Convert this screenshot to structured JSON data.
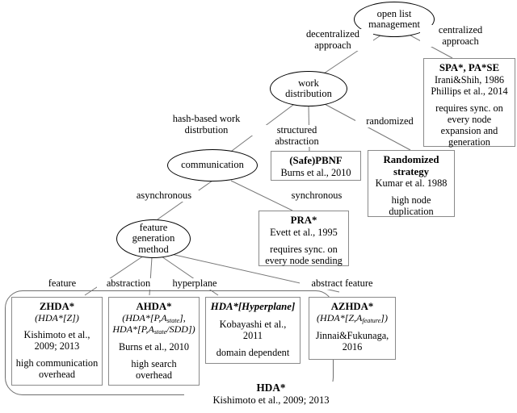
{
  "diagram": {
    "title": "open list management taxonomy",
    "root": {
      "label_line1": "open list",
      "label_line2": "management"
    },
    "nodes": {
      "work_distribution": {
        "line1": "work",
        "line2": "distribution"
      },
      "communication": {
        "line1": "communication"
      },
      "feature_generation": {
        "line1": "feature",
        "line2": "generation",
        "line3": "method"
      }
    },
    "edge_labels": {
      "decentralized": {
        "line1": "decentralized",
        "line2": "approach"
      },
      "centralized": {
        "line1": "centralized",
        "line2": "approach"
      },
      "hash_based": {
        "line1": "hash-based work",
        "line2": "distrbution"
      },
      "structured": {
        "line1": "structured",
        "line2": "abstraction"
      },
      "randomized": {
        "line1": "randomized"
      },
      "asynchronous": {
        "line1": "asynchronous"
      },
      "synchronous": {
        "line1": "synchronous"
      },
      "feature": {
        "line1": "feature"
      },
      "abstraction": {
        "line1": "abstraction"
      },
      "hyperplane": {
        "line1": "hyperplane"
      },
      "abstract_feature": {
        "line1": "abstract feature"
      }
    },
    "boxes": {
      "spa": {
        "title": "SPA*, PA*SE",
        "ref1": "Irani&Shih, 1986",
        "ref2": "Phillips et al., 2014",
        "note1": "requires sync. on",
        "note2": "every node",
        "note3": "expansion and",
        "note4": "generation"
      },
      "safepbnf": {
        "title": "(Safe)PBNF",
        "ref1": "Burns et al., 2010"
      },
      "randomized_strategy": {
        "title1": "Randomized",
        "title2": "strategy",
        "ref1": "Kumar et al. 1988",
        "note1": "high node",
        "note2": "duplication"
      },
      "pra": {
        "title": "PRA*",
        "ref1": "Evett et al., 1995",
        "note1": "requires sync. on",
        "note2": "every node sending"
      },
      "zhda": {
        "title": "ZHDA*",
        "alias": "(HDA*[Z])",
        "ref1": "Kishimoto et al.,",
        "ref2": "2009; 2013",
        "note1": "high communication",
        "note2": "overhead"
      },
      "ahda": {
        "title": "AHDA*",
        "alias_pre1": "(HDA*[P,A",
        "alias_sub1": "state",
        "alias_post1": "],",
        "alias_pre2": "HDA*[P,A",
        "alias_sub2": "state",
        "alias_post2": "/SDD])",
        "ref1": "Burns et al., 2010",
        "note1": "high search",
        "note2": "overhead"
      },
      "hyperplane_box": {
        "title": "HDA*[Hyperplane]",
        "ref1": "Kobayashi et al.,",
        "ref2": "2011",
        "note1": "domain dependent"
      },
      "azhda": {
        "title": "AZHDA*",
        "alias_pre": "(HDA*[Z,A",
        "alias_sub": "feature",
        "alias_post": "])",
        "ref1": "Jinnai&Fukunaga,",
        "ref2": "2016"
      }
    },
    "group": {
      "title": "HDA*",
      "ref": "Kishimoto et al., 2009; 2013"
    },
    "colors": {
      "stroke": "#000000",
      "box_border": "#8a8a8a",
      "edge": "#777777",
      "group_border": "#6e6e6e",
      "background": "#ffffff"
    }
  }
}
